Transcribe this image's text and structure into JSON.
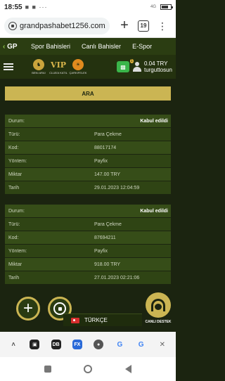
{
  "status_bar": {
    "time": "18:55",
    "notif_icons": "■ ■ ···",
    "network": "4G"
  },
  "browser": {
    "url": "grandpashabet1256.com/",
    "tab_count": "19"
  },
  "site_nav": {
    "logo": "GP",
    "items": [
      {
        "label": "Spor Bahisleri"
      },
      {
        "label": "Canlı Bahisler"
      },
      {
        "label": "E-Spor"
      }
    ]
  },
  "header": {
    "badges": [
      {
        "mark": "♞",
        "caption": "BENI ARA!"
      },
      {
        "mark": "VIP",
        "caption": "CLUB'A KATIL"
      },
      {
        "mark": "☀",
        "caption": "ÇARKIFELEK"
      }
    ],
    "balance": "0.04 TRY",
    "username": "turguttosun",
    "user_level": "1"
  },
  "search": {
    "label": "ARA"
  },
  "transactions": [
    {
      "rows": [
        {
          "label": "Durum:",
          "value": "Kabul edildi"
        },
        {
          "label": "Türü:",
          "value": "Para Çekme"
        },
        {
          "label": "Kod:",
          "value": "88017174"
        },
        {
          "label": "Yöntem:",
          "value": "Payfix"
        },
        {
          "label": "Miktar",
          "value": "147.00 TRY"
        },
        {
          "label": "Tarih",
          "value": "29.01.2023 12:04:59"
        }
      ]
    },
    {
      "rows": [
        {
          "label": "Durum:",
          "value": "Kabul edildi"
        },
        {
          "label": "Türü:",
          "value": "Para Çekme"
        },
        {
          "label": "Kod:",
          "value": "87694211"
        },
        {
          "label": "Yöntem:",
          "value": "Payfix"
        },
        {
          "label": "Miktar",
          "value": "918.00 TRY"
        },
        {
          "label": "Tarih",
          "value": "27.01.2023 02:21:06"
        }
      ]
    }
  ],
  "language": {
    "label": "TÜRKÇE"
  },
  "support": {
    "label": "CANLI DESTEK"
  },
  "dock": {
    "icons": [
      {
        "name": "chevron-up-icon",
        "glyph": "˄"
      },
      {
        "name": "app-icon-1",
        "glyph": "▣"
      },
      {
        "name": "app-icon-2",
        "glyph": "DB"
      },
      {
        "name": "app-icon-3",
        "glyph": "FX"
      },
      {
        "name": "app-icon-4",
        "glyph": "●"
      },
      {
        "name": "google-icon-1",
        "glyph": "G"
      },
      {
        "name": "google-icon-2",
        "glyph": "G"
      },
      {
        "name": "close-icon",
        "glyph": "✕"
      }
    ]
  }
}
